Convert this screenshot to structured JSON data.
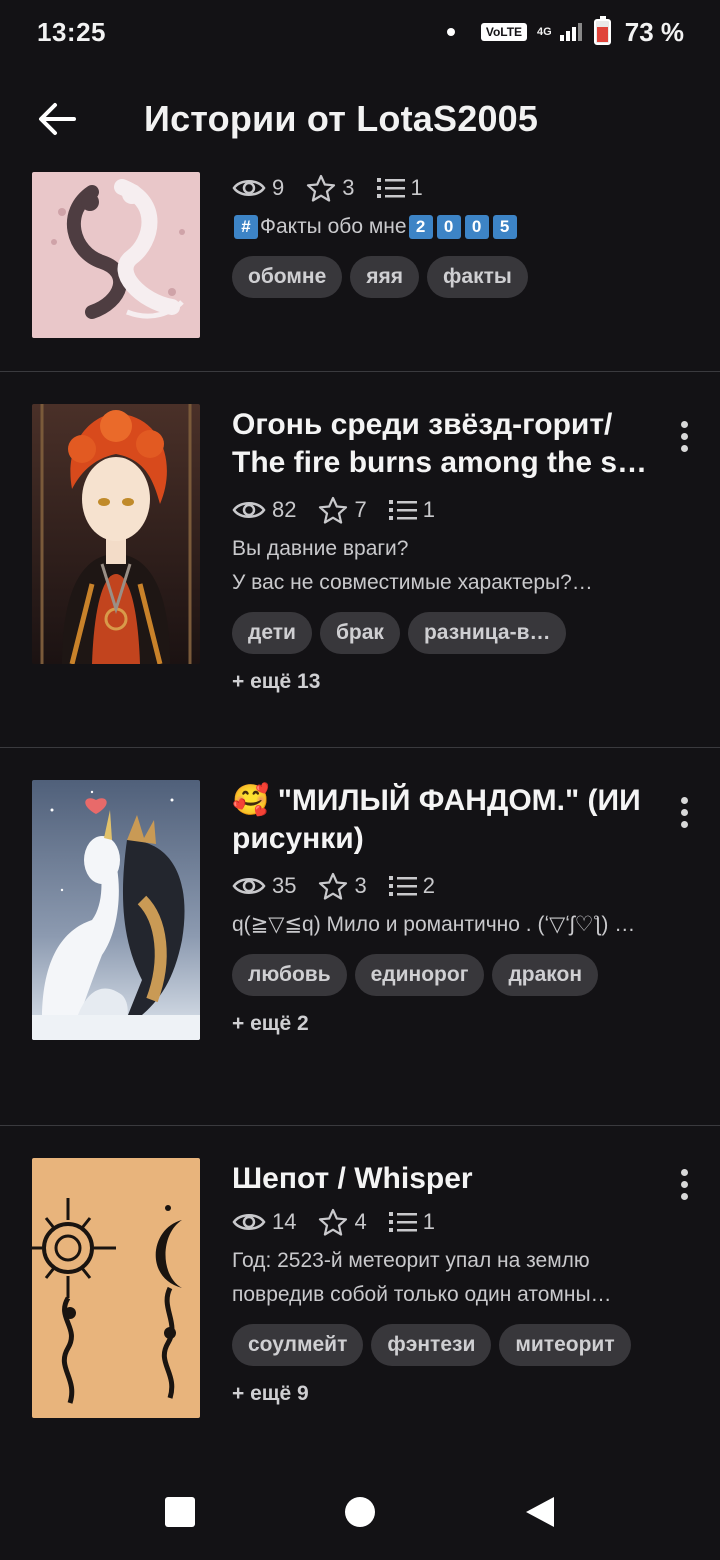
{
  "status_bar": {
    "time": "13:25",
    "volte": "VoLTE",
    "network": "4G",
    "battery_percent": "73 %",
    "battery_level": 0.73
  },
  "header": {
    "title": "Истории от LotaS2005",
    "back_icon": "arrow-left-icon"
  },
  "stories": [
    {
      "title": "",
      "views": "9",
      "stars": "3",
      "parts": "1",
      "description_prefix": "Факты обо мне",
      "description_keycaps": [
        "#",
        "2",
        "0",
        "0",
        "5"
      ],
      "tags": [
        "обомне",
        "яяя",
        "факты"
      ],
      "more": "",
      "cover_colors": [
        "#e8c6c8",
        "#4a3a3d"
      ]
    },
    {
      "title": "Огонь среди звёзд-горит/ The fire burns among the s…",
      "views": "82",
      "stars": "7",
      "parts": "1",
      "description": "Вы давние враги?\nУ вас не совместимые характеры?…",
      "tags": [
        "дети",
        "брак",
        "разница-в…"
      ],
      "more": "+ ещё 13",
      "cover_colors": [
        "#3a1e1a",
        "#d4522a"
      ]
    },
    {
      "title": "🥰 \"МИЛЫЙ ФАНДОМ.\" (ИИ рисунки)",
      "views": "35",
      "stars": "3",
      "parts": "2",
      "description": "q(≧▽≦q) Мило и романтично . (ʻ▽ʻʃ♡ƪ) …",
      "tags": [
        "любовь",
        "единорог",
        "дракон"
      ],
      "more": "+ ещё 2",
      "cover_colors": [
        "#7a8aa0",
        "#e8eef5"
      ]
    },
    {
      "title": "Шепот / Whisper",
      "views": "14",
      "stars": "4",
      "parts": "1",
      "description": "Год: 2523-й метеорит упал на землю повредив собой только один атомны…",
      "tags": [
        "соулмейт",
        "фэнтези",
        "митеорит"
      ],
      "more": "+ ещё 9",
      "cover_colors": [
        "#e7b47c",
        "#1a1410"
      ]
    }
  ],
  "icons": {
    "views": "eye-icon",
    "stars": "star-icon",
    "parts": "list-icon",
    "menu": "more-vertical-icon"
  },
  "nav_bar": {
    "recents": "square-icon",
    "home": "circle-icon",
    "back": "triangle-back-icon"
  }
}
